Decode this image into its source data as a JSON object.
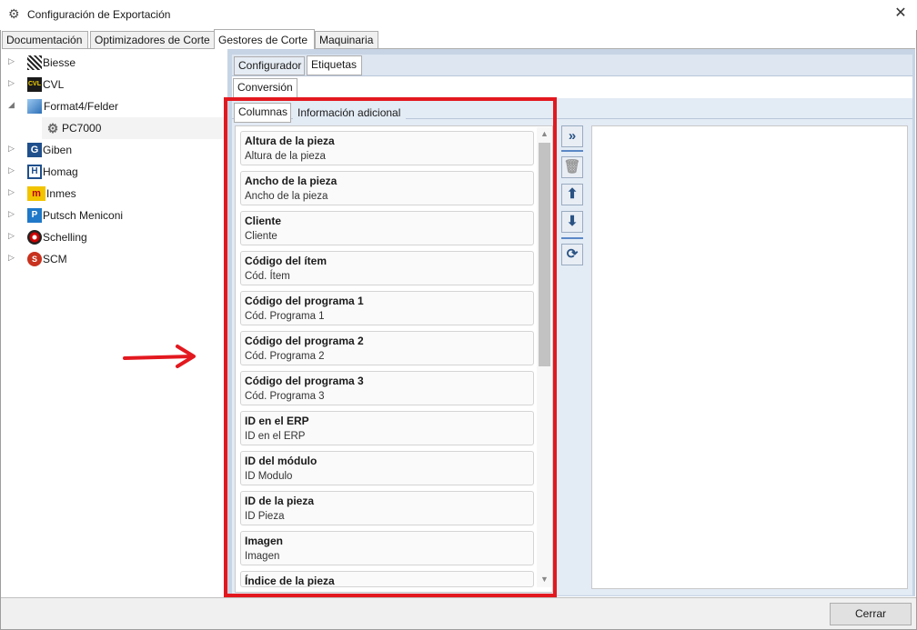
{
  "window": {
    "title": "Configuración de Exportación",
    "icon": "gear-icon"
  },
  "main_tabs": [
    {
      "label": "Documentación"
    },
    {
      "label": "Optimizadores de Corte"
    },
    {
      "label": "Gestores de Corte",
      "active": true
    },
    {
      "label": "Maquinaria"
    }
  ],
  "tree": [
    {
      "label": "Biesse",
      "icon": "biesse-logo-icon",
      "badge": ""
    },
    {
      "label": "CVL",
      "icon": "cvl-logo-icon",
      "badge": "CVL"
    },
    {
      "label": "Format4/Felder",
      "icon": "format4-logo-icon",
      "badge": ""
    },
    {
      "label": "PC7000",
      "icon": "gear-icon",
      "badge": "⚙"
    },
    {
      "label": "Giben",
      "icon": "giben-logo-icon",
      "badge": "G"
    },
    {
      "label": "Homag",
      "icon": "homag-logo-icon",
      "badge": "H"
    },
    {
      "label": "Inmes",
      "icon": "inmes-logo-icon",
      "badge": "m"
    },
    {
      "label": "Putsch Meniconi",
      "icon": "putsch-logo-icon",
      "badge": "P"
    },
    {
      "label": "Schelling",
      "icon": "schelling-logo-icon",
      "badge": ""
    },
    {
      "label": "SCM",
      "icon": "scm-logo-icon",
      "badge": "S"
    }
  ],
  "sub_tabs": [
    {
      "label": "Configurador"
    },
    {
      "label": "Etiquetas",
      "active": true
    }
  ],
  "sub_sub_tab": {
    "label": "Conversión"
  },
  "inner_tabs": [
    {
      "label": "Columnas",
      "active": true
    },
    {
      "label": "Información adicional"
    }
  ],
  "columns": [
    {
      "title": "Altura de la pieza",
      "sub": "Altura de la pieza"
    },
    {
      "title": "Ancho de la pieza",
      "sub": "Ancho de la pieza"
    },
    {
      "title": "Cliente",
      "sub": "Cliente"
    },
    {
      "title": "Código del ítem",
      "sub": "Cód. Ítem"
    },
    {
      "title": "Código del programa 1",
      "sub": "Cód. Programa 1"
    },
    {
      "title": "Código del programa 2",
      "sub": "Cód. Programa 2"
    },
    {
      "title": "Código del programa 3",
      "sub": "Cód. Programa 3"
    },
    {
      "title": "ID en el ERP",
      "sub": "ID en el ERP"
    },
    {
      "title": "ID del módulo",
      "sub": "ID Modulo"
    },
    {
      "title": "ID de la pieza",
      "sub": "ID Pieza"
    },
    {
      "title": "Imagen",
      "sub": "Imagen"
    },
    {
      "title": "Índice de la pieza",
      "sub": ""
    }
  ],
  "toolbar": [
    "add-all-icon",
    "delete-icon",
    "move-up-icon",
    "move-down-icon",
    "refresh-icon"
  ],
  "footer": {
    "close_label": "Cerrar"
  },
  "colors": {
    "highlight": "#e3181f",
    "accent": "#2a5384"
  }
}
